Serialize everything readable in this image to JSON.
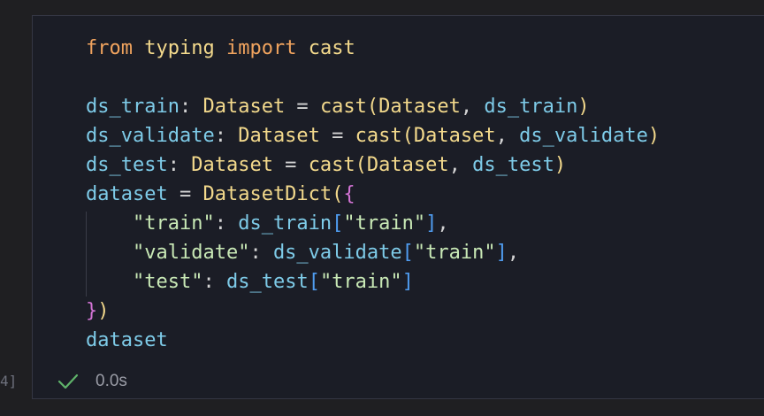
{
  "cell": {
    "execution_count": "4]",
    "status_icon": "check-icon",
    "exec_time": "0.0s",
    "code_lines": [
      [
        {
          "t": "from",
          "c": "kw"
        },
        {
          "t": " ",
          "c": "op"
        },
        {
          "t": "typing",
          "c": "fn"
        },
        {
          "t": " ",
          "c": "op"
        },
        {
          "t": "import",
          "c": "kw"
        },
        {
          "t": " ",
          "c": "op"
        },
        {
          "t": "cast",
          "c": "fn"
        }
      ],
      [],
      [
        {
          "t": "ds_train",
          "c": "var"
        },
        {
          "t": ": ",
          "c": "op"
        },
        {
          "t": "Dataset",
          "c": "fn"
        },
        {
          "t": " = ",
          "c": "op"
        },
        {
          "t": "cast",
          "c": "fn"
        },
        {
          "t": "(",
          "c": "br1"
        },
        {
          "t": "Dataset",
          "c": "fn"
        },
        {
          "t": ", ",
          "c": "op"
        },
        {
          "t": "ds_train",
          "c": "var"
        },
        {
          "t": ")",
          "c": "br1"
        }
      ],
      [
        {
          "t": "ds_validate",
          "c": "var"
        },
        {
          "t": ": ",
          "c": "op"
        },
        {
          "t": "Dataset",
          "c": "fn"
        },
        {
          "t": " = ",
          "c": "op"
        },
        {
          "t": "cast",
          "c": "fn"
        },
        {
          "t": "(",
          "c": "br1"
        },
        {
          "t": "Dataset",
          "c": "fn"
        },
        {
          "t": ", ",
          "c": "op"
        },
        {
          "t": "ds_validate",
          "c": "var"
        },
        {
          "t": ")",
          "c": "br1"
        }
      ],
      [
        {
          "t": "ds_test",
          "c": "var"
        },
        {
          "t": ": ",
          "c": "op"
        },
        {
          "t": "Dataset",
          "c": "fn"
        },
        {
          "t": " = ",
          "c": "op"
        },
        {
          "t": "cast",
          "c": "fn"
        },
        {
          "t": "(",
          "c": "br1"
        },
        {
          "t": "Dataset",
          "c": "fn"
        },
        {
          "t": ", ",
          "c": "op"
        },
        {
          "t": "ds_test",
          "c": "var"
        },
        {
          "t": ")",
          "c": "br1"
        }
      ],
      [
        {
          "t": "dataset",
          "c": "var"
        },
        {
          "t": " = ",
          "c": "op"
        },
        {
          "t": "DatasetDict",
          "c": "fn"
        },
        {
          "t": "(",
          "c": "br1"
        },
        {
          "t": "{",
          "c": "br2"
        }
      ],
      [
        {
          "t": "    ",
          "c": "op"
        },
        {
          "t": "\"train\"",
          "c": "str"
        },
        {
          "t": ": ",
          "c": "op"
        },
        {
          "t": "ds_train",
          "c": "var"
        },
        {
          "t": "[",
          "c": "br3"
        },
        {
          "t": "\"train\"",
          "c": "str"
        },
        {
          "t": "]",
          "c": "br3"
        },
        {
          "t": ",",
          "c": "op"
        }
      ],
      [
        {
          "t": "    ",
          "c": "op"
        },
        {
          "t": "\"validate\"",
          "c": "str"
        },
        {
          "t": ": ",
          "c": "op"
        },
        {
          "t": "ds_validate",
          "c": "var"
        },
        {
          "t": "[",
          "c": "br3"
        },
        {
          "t": "\"train\"",
          "c": "str"
        },
        {
          "t": "]",
          "c": "br3"
        },
        {
          "t": ",",
          "c": "op"
        }
      ],
      [
        {
          "t": "    ",
          "c": "op"
        },
        {
          "t": "\"test\"",
          "c": "str"
        },
        {
          "t": ": ",
          "c": "op"
        },
        {
          "t": "ds_test",
          "c": "var"
        },
        {
          "t": "[",
          "c": "br3"
        },
        {
          "t": "\"train\"",
          "c": "str"
        },
        {
          "t": "]",
          "c": "br3"
        }
      ],
      [
        {
          "t": "}",
          "c": "br2"
        },
        {
          "t": ")",
          "c": "br1"
        }
      ],
      [
        {
          "t": "dataset",
          "c": "var"
        }
      ]
    ]
  },
  "colors": {
    "keyword": "#f0a35e",
    "function": "#f3d98c",
    "variable": "#7ecbe8",
    "string": "#c9e9b6",
    "success_check": "#5fb36a"
  }
}
